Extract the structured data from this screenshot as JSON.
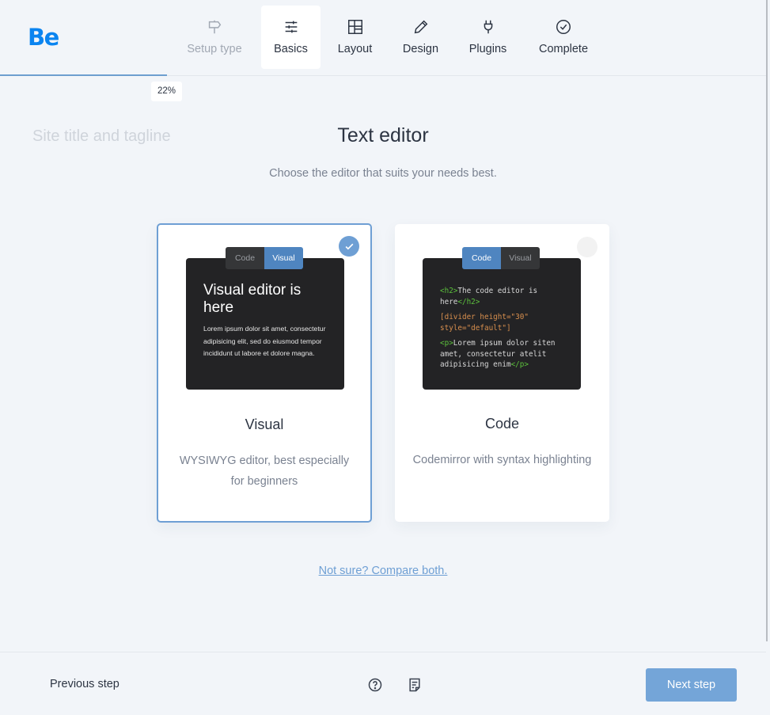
{
  "brand": {
    "logo_text": "Be",
    "color": "#0a84f0"
  },
  "header": {
    "steps": [
      {
        "label": "Setup type",
        "icon": "signpost-icon",
        "state": "done"
      },
      {
        "label": "Basics",
        "icon": "sliders-icon",
        "state": "active"
      },
      {
        "label": "Layout",
        "icon": "layout-icon",
        "state": "pending"
      },
      {
        "label": "Design",
        "icon": "pencil-icon",
        "state": "pending"
      },
      {
        "label": "Plugins",
        "icon": "plug-icon",
        "state": "pending"
      },
      {
        "label": "Complete",
        "icon": "check-circle-icon",
        "state": "pending"
      }
    ],
    "theme_toggle_icon": "moon-icon"
  },
  "progress": {
    "value_percent": 22,
    "label": "22%"
  },
  "main": {
    "side_title": "Site title and tagline",
    "title": "Text editor",
    "subtitle": "Choose the editor that suits your needs best.",
    "options": [
      {
        "id": "visual",
        "selected": true,
        "title": "Visual",
        "description": "WYSIWYG editor, best especially for beginners",
        "preview": {
          "tabs": [
            "Code",
            "Visual"
          ],
          "active_tab": "Visual",
          "heading": "Visual editor is here",
          "body": "Lorem ipsum dolor sit amet, consectetur adipisicing elit, sed do eiusmod tempor incididunt ut labore et dolore magna."
        }
      },
      {
        "id": "code",
        "selected": false,
        "title": "Code",
        "description": "Codemirror with syntax highlighting",
        "preview": {
          "tabs": [
            "Code",
            "Visual"
          ],
          "active_tab": "Code",
          "line1_open": "<h2>",
          "line1_text": "The code editor is here",
          "line1_close": "</h2>",
          "line2": "[divider height=\"30\" style=\"default\"]",
          "line3_open": "<p>",
          "line3_text": "Lorem ipsum dolor siten amet, consectetur atelit adipisicing enim",
          "line3_close": "</p>"
        }
      }
    ],
    "compare_link": "Not sure? Compare both."
  },
  "footer": {
    "previous_label": "Previous step",
    "help_icon": "help-circle-icon",
    "notes_icon": "notes-icon",
    "next_label": "Next step"
  },
  "colors": {
    "accent": "#6e9fd4",
    "next_button": "#74a5d8",
    "background": "#f2f5f9"
  }
}
